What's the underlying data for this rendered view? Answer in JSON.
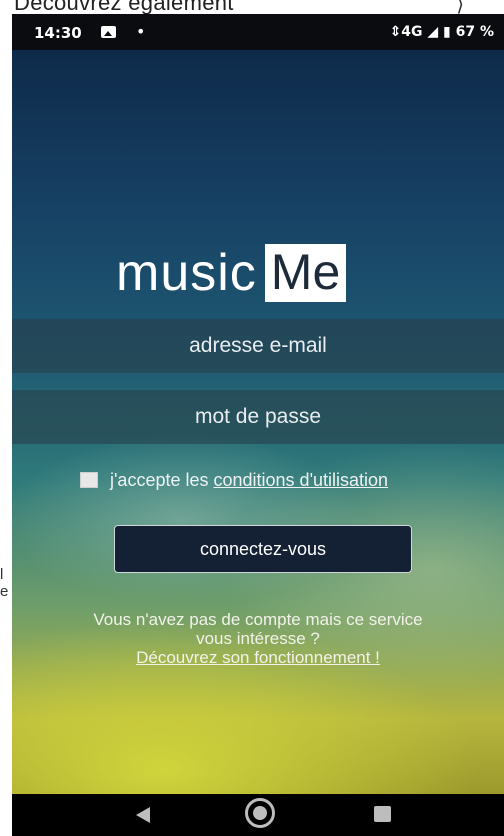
{
  "background": {
    "top_text": "Découvrez également",
    "arrow": "⟩",
    "side_text": [
      "l",
      "e"
    ]
  },
  "status_bar": {
    "time": "14:30",
    "notification_icon": "image-icon",
    "dot": "•",
    "right": "⇕4G ◢ ▮ 67 %"
  },
  "app": {
    "logo_music": "music",
    "logo_me": "Me",
    "email_placeholder": "adresse e-mail",
    "password_placeholder": "mot de passe",
    "terms_prefix": "j'accepte les",
    "terms_link": "conditions d'utilisation",
    "connect_button": "connectez-vous",
    "promo_line1": "Vous n'avez pas de compte mais ce service",
    "promo_line2": "vous intéresse ?",
    "discover_link": "Découvrez son fonctionnement !"
  },
  "nav_bar": {
    "back": "back-icon",
    "home": "home-icon",
    "recent": "recent-apps-icon"
  }
}
